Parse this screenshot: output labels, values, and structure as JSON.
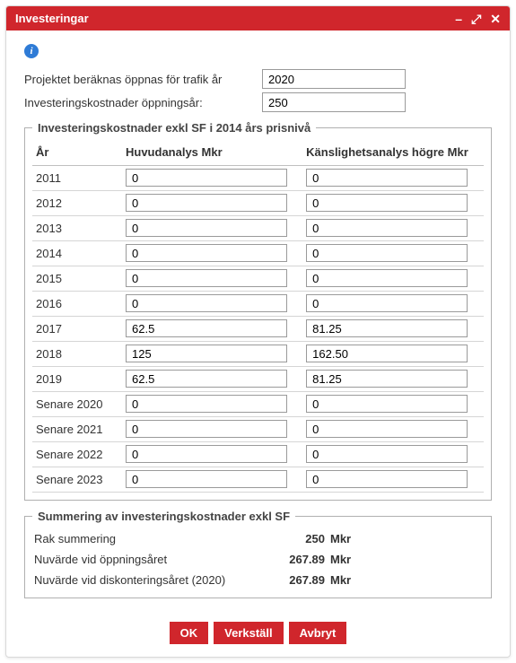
{
  "window": {
    "title": "Investeringar"
  },
  "header": {
    "projekt_label": "Projektet beräknas öppnas för trafik år",
    "projekt_value": "2020",
    "kostnader_label": "Investeringskostnader öppningsår:",
    "kostnader_value": "250"
  },
  "costs": {
    "legend": "Investeringskostnader exkl SF i 2014 års prisnivå",
    "col_year": "År",
    "col_main": "Huvudanalys Mkr",
    "col_sens": "Känslighetsanalys högre Mkr",
    "rows": [
      {
        "year": "2011",
        "main": "0",
        "sens": "0"
      },
      {
        "year": "2012",
        "main": "0",
        "sens": "0"
      },
      {
        "year": "2013",
        "main": "0",
        "sens": "0"
      },
      {
        "year": "2014",
        "main": "0",
        "sens": "0"
      },
      {
        "year": "2015",
        "main": "0",
        "sens": "0"
      },
      {
        "year": "2016",
        "main": "0",
        "sens": "0"
      },
      {
        "year": "2017",
        "main": "62.5",
        "sens": "81.25"
      },
      {
        "year": "2018",
        "main": "125",
        "sens": "162.50"
      },
      {
        "year": "2019",
        "main": "62.5",
        "sens": "81.25"
      },
      {
        "year": "Senare 2020",
        "main": "0",
        "sens": "0"
      },
      {
        "year": "Senare 2021",
        "main": "0",
        "sens": "0"
      },
      {
        "year": "Senare 2022",
        "main": "0",
        "sens": "0"
      },
      {
        "year": "Senare 2023",
        "main": "0",
        "sens": "0"
      }
    ]
  },
  "summary": {
    "legend": "Summering av investeringskostnader exkl SF",
    "rows": [
      {
        "label": "Rak summering",
        "value": "250",
        "unit": "Mkr"
      },
      {
        "label": "Nuvärde vid öppningsåret",
        "value": "267.89",
        "unit": "Mkr"
      },
      {
        "label": "Nuvärde vid diskonteringsåret (2020)",
        "value": "267.89",
        "unit": "Mkr"
      }
    ]
  },
  "buttons": {
    "ok": "OK",
    "apply": "Verkställ",
    "cancel": "Avbryt"
  }
}
